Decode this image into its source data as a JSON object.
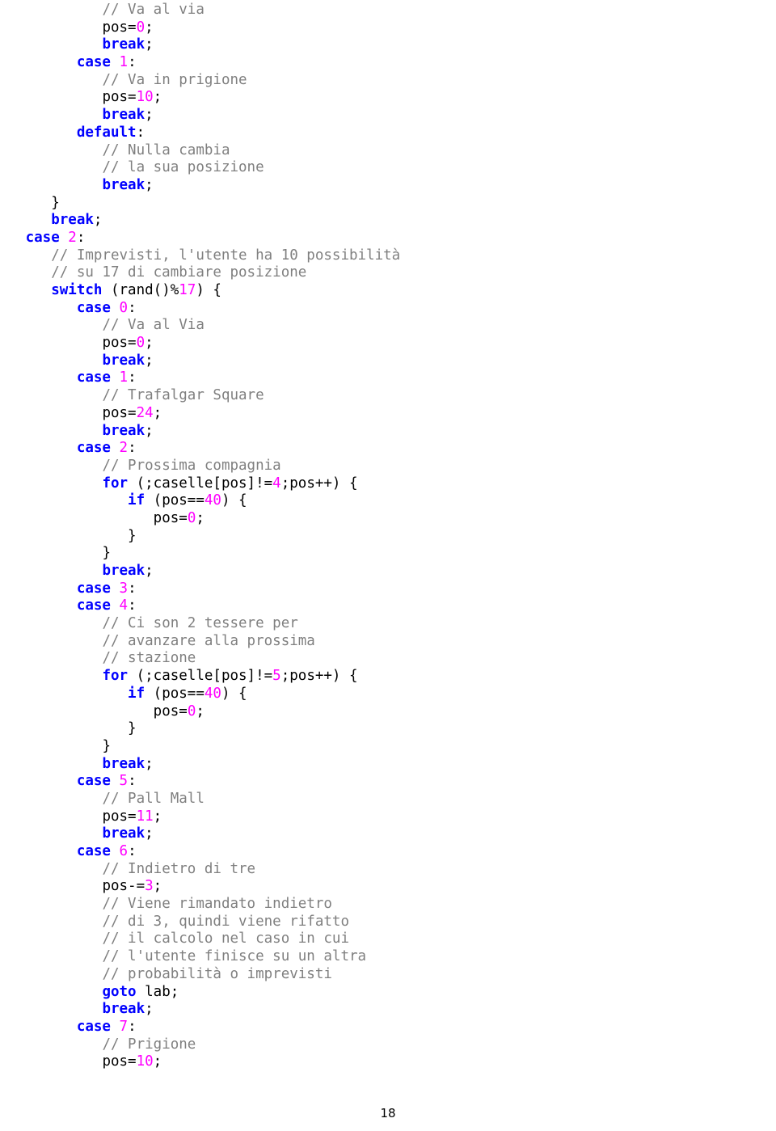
{
  "page": {
    "number": "18",
    "colors": {
      "keyword": "#0000ff",
      "comment": "#808080",
      "number": "#ff00ff",
      "plain": "#000000",
      "background": "#ffffff"
    }
  },
  "code": {
    "lines": [
      [
        {
          "t": "            ",
          "c": "pl"
        },
        {
          "t": "// Va al via",
          "c": "cm"
        }
      ],
      [
        {
          "t": "            ",
          "c": "pl"
        },
        {
          "t": "pos=",
          "c": "pl"
        },
        {
          "t": "0",
          "c": "num"
        },
        {
          "t": ";",
          "c": "pl"
        }
      ],
      [
        {
          "t": "            ",
          "c": "pl"
        },
        {
          "t": "break",
          "c": "kw"
        },
        {
          "t": ";",
          "c": "pl"
        }
      ],
      [
        {
          "t": "         ",
          "c": "pl"
        },
        {
          "t": "case ",
          "c": "kw"
        },
        {
          "t": "1",
          "c": "num"
        },
        {
          "t": ":",
          "c": "pl"
        }
      ],
      [
        {
          "t": "            ",
          "c": "pl"
        },
        {
          "t": "// Va in prigione",
          "c": "cm"
        }
      ],
      [
        {
          "t": "            ",
          "c": "pl"
        },
        {
          "t": "pos=",
          "c": "pl"
        },
        {
          "t": "10",
          "c": "num"
        },
        {
          "t": ";",
          "c": "pl"
        }
      ],
      [
        {
          "t": "            ",
          "c": "pl"
        },
        {
          "t": "break",
          "c": "kw"
        },
        {
          "t": ";",
          "c": "pl"
        }
      ],
      [
        {
          "t": "         ",
          "c": "pl"
        },
        {
          "t": "default",
          "c": "kw"
        },
        {
          "t": ":",
          "c": "pl"
        }
      ],
      [
        {
          "t": "            ",
          "c": "pl"
        },
        {
          "t": "// Nulla cambia",
          "c": "cm"
        }
      ],
      [
        {
          "t": "            ",
          "c": "pl"
        },
        {
          "t": "// la sua posizione",
          "c": "cm"
        }
      ],
      [
        {
          "t": "            ",
          "c": "pl"
        },
        {
          "t": "break",
          "c": "kw"
        },
        {
          "t": ";",
          "c": "pl"
        }
      ],
      [
        {
          "t": "      ",
          "c": "pl"
        },
        {
          "t": "}",
          "c": "pl"
        }
      ],
      [
        {
          "t": "      ",
          "c": "pl"
        },
        {
          "t": "break",
          "c": "kw"
        },
        {
          "t": ";",
          "c": "pl"
        }
      ],
      [
        {
          "t": "   ",
          "c": "pl"
        },
        {
          "t": "case ",
          "c": "kw"
        },
        {
          "t": "2",
          "c": "num"
        },
        {
          "t": ":",
          "c": "pl"
        }
      ],
      [
        {
          "t": "      ",
          "c": "pl"
        },
        {
          "t": "// Imprevisti, l'utente ha 10 possibilità",
          "c": "cm"
        }
      ],
      [
        {
          "t": "      ",
          "c": "pl"
        },
        {
          "t": "// su 17 di cambiare posizione",
          "c": "cm"
        }
      ],
      [
        {
          "t": "      ",
          "c": "pl"
        },
        {
          "t": "switch",
          "c": "kw"
        },
        {
          "t": " (rand()%",
          "c": "pl"
        },
        {
          "t": "17",
          "c": "num"
        },
        {
          "t": ") {",
          "c": "pl"
        }
      ],
      [
        {
          "t": "         ",
          "c": "pl"
        },
        {
          "t": "case ",
          "c": "kw"
        },
        {
          "t": "0",
          "c": "num"
        },
        {
          "t": ":",
          "c": "pl"
        }
      ],
      [
        {
          "t": "            ",
          "c": "pl"
        },
        {
          "t": "// Va al Via",
          "c": "cm"
        }
      ],
      [
        {
          "t": "            ",
          "c": "pl"
        },
        {
          "t": "pos=",
          "c": "pl"
        },
        {
          "t": "0",
          "c": "num"
        },
        {
          "t": ";",
          "c": "pl"
        }
      ],
      [
        {
          "t": "            ",
          "c": "pl"
        },
        {
          "t": "break",
          "c": "kw"
        },
        {
          "t": ";",
          "c": "pl"
        }
      ],
      [
        {
          "t": "         ",
          "c": "pl"
        },
        {
          "t": "case ",
          "c": "kw"
        },
        {
          "t": "1",
          "c": "num"
        },
        {
          "t": ":",
          "c": "pl"
        }
      ],
      [
        {
          "t": "            ",
          "c": "pl"
        },
        {
          "t": "// Trafalgar Square",
          "c": "cm"
        }
      ],
      [
        {
          "t": "            ",
          "c": "pl"
        },
        {
          "t": "pos=",
          "c": "pl"
        },
        {
          "t": "24",
          "c": "num"
        },
        {
          "t": ";",
          "c": "pl"
        }
      ],
      [
        {
          "t": "            ",
          "c": "pl"
        },
        {
          "t": "break",
          "c": "kw"
        },
        {
          "t": ";",
          "c": "pl"
        }
      ],
      [
        {
          "t": "         ",
          "c": "pl"
        },
        {
          "t": "case ",
          "c": "kw"
        },
        {
          "t": "2",
          "c": "num"
        },
        {
          "t": ":",
          "c": "pl"
        }
      ],
      [
        {
          "t": "            ",
          "c": "pl"
        },
        {
          "t": "// Prossima compagnia",
          "c": "cm"
        }
      ],
      [
        {
          "t": "            ",
          "c": "pl"
        },
        {
          "t": "for",
          "c": "kw"
        },
        {
          "t": " (;caselle[pos]!=",
          "c": "pl"
        },
        {
          "t": "4",
          "c": "num"
        },
        {
          "t": ";pos++) {",
          "c": "pl"
        }
      ],
      [
        {
          "t": "               ",
          "c": "pl"
        },
        {
          "t": "if",
          "c": "kw"
        },
        {
          "t": " (pos==",
          "c": "pl"
        },
        {
          "t": "40",
          "c": "num"
        },
        {
          "t": ") {",
          "c": "pl"
        }
      ],
      [
        {
          "t": "                  ",
          "c": "pl"
        },
        {
          "t": "pos=",
          "c": "pl"
        },
        {
          "t": "0",
          "c": "num"
        },
        {
          "t": ";",
          "c": "pl"
        }
      ],
      [
        {
          "t": "               ",
          "c": "pl"
        },
        {
          "t": "}",
          "c": "pl"
        }
      ],
      [
        {
          "t": "            ",
          "c": "pl"
        },
        {
          "t": "}",
          "c": "pl"
        }
      ],
      [
        {
          "t": "            ",
          "c": "pl"
        },
        {
          "t": "break",
          "c": "kw"
        },
        {
          "t": ";",
          "c": "pl"
        }
      ],
      [
        {
          "t": "         ",
          "c": "pl"
        },
        {
          "t": "case ",
          "c": "kw"
        },
        {
          "t": "3",
          "c": "num"
        },
        {
          "t": ":",
          "c": "pl"
        }
      ],
      [
        {
          "t": "         ",
          "c": "pl"
        },
        {
          "t": "case ",
          "c": "kw"
        },
        {
          "t": "4",
          "c": "num"
        },
        {
          "t": ":",
          "c": "pl"
        }
      ],
      [
        {
          "t": "            ",
          "c": "pl"
        },
        {
          "t": "// Ci son 2 tessere per",
          "c": "cm"
        }
      ],
      [
        {
          "t": "            ",
          "c": "pl"
        },
        {
          "t": "// avanzare alla prossima",
          "c": "cm"
        }
      ],
      [
        {
          "t": "            ",
          "c": "pl"
        },
        {
          "t": "// stazione",
          "c": "cm"
        }
      ],
      [
        {
          "t": "            ",
          "c": "pl"
        },
        {
          "t": "for",
          "c": "kw"
        },
        {
          "t": " (;caselle[pos]!=",
          "c": "pl"
        },
        {
          "t": "5",
          "c": "num"
        },
        {
          "t": ";pos++) {",
          "c": "pl"
        }
      ],
      [
        {
          "t": "               ",
          "c": "pl"
        },
        {
          "t": "if",
          "c": "kw"
        },
        {
          "t": " (pos==",
          "c": "pl"
        },
        {
          "t": "40",
          "c": "num"
        },
        {
          "t": ") {",
          "c": "pl"
        }
      ],
      [
        {
          "t": "                  ",
          "c": "pl"
        },
        {
          "t": "pos=",
          "c": "pl"
        },
        {
          "t": "0",
          "c": "num"
        },
        {
          "t": ";",
          "c": "pl"
        }
      ],
      [
        {
          "t": "               ",
          "c": "pl"
        },
        {
          "t": "}",
          "c": "pl"
        }
      ],
      [
        {
          "t": "            ",
          "c": "pl"
        },
        {
          "t": "}",
          "c": "pl"
        }
      ],
      [
        {
          "t": "            ",
          "c": "pl"
        },
        {
          "t": "break",
          "c": "kw"
        },
        {
          "t": ";",
          "c": "pl"
        }
      ],
      [
        {
          "t": "         ",
          "c": "pl"
        },
        {
          "t": "case ",
          "c": "kw"
        },
        {
          "t": "5",
          "c": "num"
        },
        {
          "t": ":",
          "c": "pl"
        }
      ],
      [
        {
          "t": "            ",
          "c": "pl"
        },
        {
          "t": "// Pall Mall",
          "c": "cm"
        }
      ],
      [
        {
          "t": "            ",
          "c": "pl"
        },
        {
          "t": "pos=",
          "c": "pl"
        },
        {
          "t": "11",
          "c": "num"
        },
        {
          "t": ";",
          "c": "pl"
        }
      ],
      [
        {
          "t": "            ",
          "c": "pl"
        },
        {
          "t": "break",
          "c": "kw"
        },
        {
          "t": ";",
          "c": "pl"
        }
      ],
      [
        {
          "t": "         ",
          "c": "pl"
        },
        {
          "t": "case ",
          "c": "kw"
        },
        {
          "t": "6",
          "c": "num"
        },
        {
          "t": ":",
          "c": "pl"
        }
      ],
      [
        {
          "t": "            ",
          "c": "pl"
        },
        {
          "t": "// Indietro di tre",
          "c": "cm"
        }
      ],
      [
        {
          "t": "            ",
          "c": "pl"
        },
        {
          "t": "pos-=",
          "c": "pl"
        },
        {
          "t": "3",
          "c": "num"
        },
        {
          "t": ";",
          "c": "pl"
        }
      ],
      [
        {
          "t": "            ",
          "c": "pl"
        },
        {
          "t": "// Viene rimandato indietro",
          "c": "cm"
        }
      ],
      [
        {
          "t": "            ",
          "c": "pl"
        },
        {
          "t": "// di 3, quindi viene rifatto",
          "c": "cm"
        }
      ],
      [
        {
          "t": "            ",
          "c": "pl"
        },
        {
          "t": "// il calcolo nel caso in cui",
          "c": "cm"
        }
      ],
      [
        {
          "t": "            ",
          "c": "pl"
        },
        {
          "t": "// l'utente finisce su un altra",
          "c": "cm"
        }
      ],
      [
        {
          "t": "            ",
          "c": "pl"
        },
        {
          "t": "// probabilità o imprevisti",
          "c": "cm"
        }
      ],
      [
        {
          "t": "            ",
          "c": "pl"
        },
        {
          "t": "goto",
          "c": "kw"
        },
        {
          "t": " lab;",
          "c": "pl"
        }
      ],
      [
        {
          "t": "            ",
          "c": "pl"
        },
        {
          "t": "break",
          "c": "kw"
        },
        {
          "t": ";",
          "c": "pl"
        }
      ],
      [
        {
          "t": "         ",
          "c": "pl"
        },
        {
          "t": "case ",
          "c": "kw"
        },
        {
          "t": "7",
          "c": "num"
        },
        {
          "t": ":",
          "c": "pl"
        }
      ],
      [
        {
          "t": "            ",
          "c": "pl"
        },
        {
          "t": "// Prigione",
          "c": "cm"
        }
      ],
      [
        {
          "t": "            ",
          "c": "pl"
        },
        {
          "t": "pos=",
          "c": "pl"
        },
        {
          "t": "10",
          "c": "num"
        },
        {
          "t": ";",
          "c": "pl"
        }
      ]
    ]
  }
}
